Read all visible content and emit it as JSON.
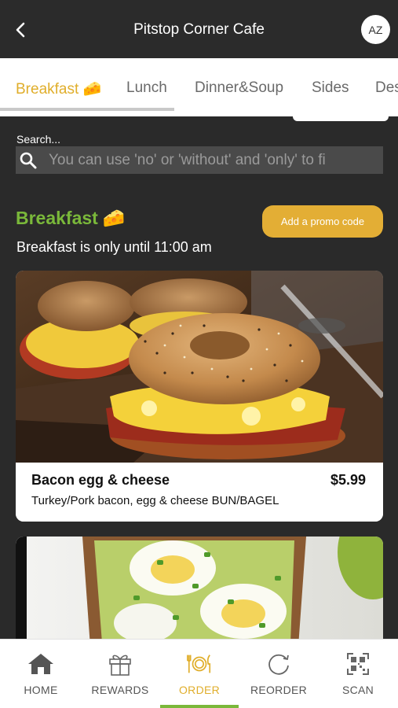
{
  "header": {
    "title": "Pitstop Corner Cafe",
    "avatar_initials": "AZ"
  },
  "tabs": [
    {
      "label": "Breakfast 🧀",
      "active": true
    },
    {
      "label": "Lunch",
      "active": false
    },
    {
      "label": "Dinner&Soup",
      "active": false
    },
    {
      "label": "Sides",
      "active": false
    },
    {
      "label": "Des",
      "active": false
    }
  ],
  "search": {
    "label": "Search...",
    "placeholder": "You can use 'no' or 'without' and 'only' to fi"
  },
  "section": {
    "title": "Breakfast",
    "title_emoji": "🧀",
    "subtitle": "Breakfast is only until 11:00 am",
    "promo_label": "Add a promo code"
  },
  "items": [
    {
      "name": "Bacon egg & cheese",
      "price": "$5.99",
      "description": "Turkey/Pork bacon, egg & cheese BUN/BAGEL"
    }
  ],
  "nav": [
    {
      "label": "HOME",
      "icon": "home-icon",
      "active": false
    },
    {
      "label": "REWARDS",
      "icon": "gift-icon",
      "active": false
    },
    {
      "label": "ORDER",
      "icon": "plate-cutlery-icon",
      "active": true
    },
    {
      "label": "REORDER",
      "icon": "reorder-icon",
      "active": false
    },
    {
      "label": "SCAN",
      "icon": "qr-code-icon",
      "active": false
    }
  ],
  "colors": {
    "accent_gold": "#e0ae2b",
    "accent_green": "#7ab83a",
    "header_bg": "#2b2b2b",
    "page_bg": "#2a2a2a"
  }
}
